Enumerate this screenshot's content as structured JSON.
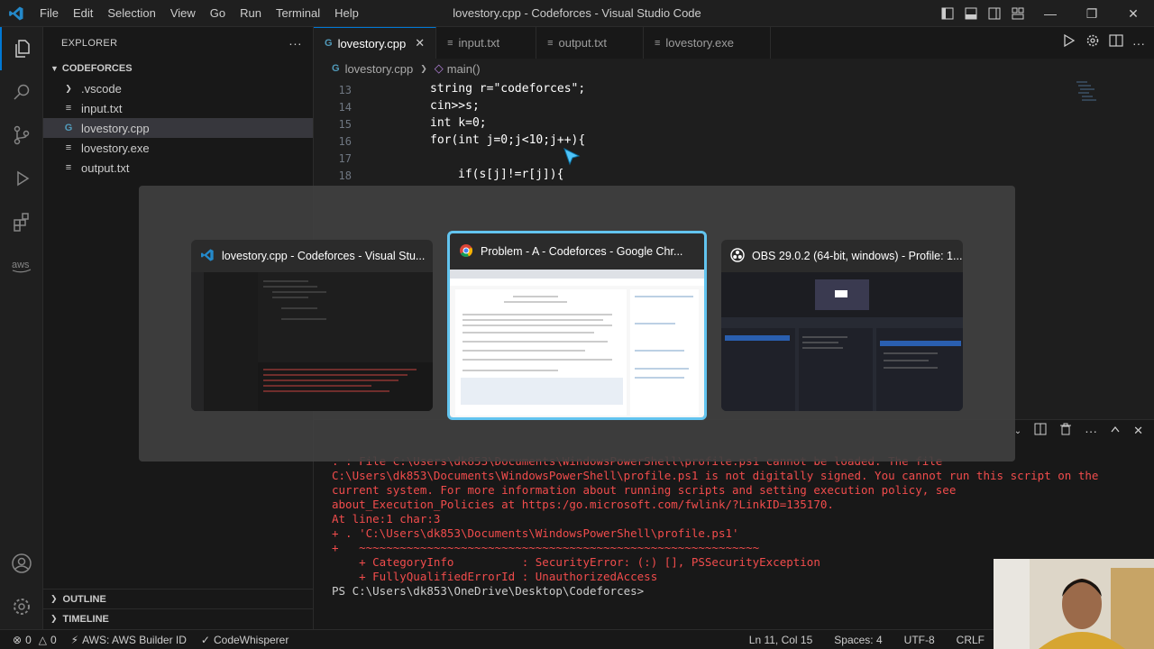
{
  "window": {
    "title": "lovestory.cpp - Codeforces - Visual Studio Code",
    "menu": [
      "File",
      "Edit",
      "Selection",
      "View",
      "Go",
      "Run",
      "Terminal",
      "Help"
    ]
  },
  "sidebar": {
    "header": "EXPLORER",
    "folder": "CODEFORCES",
    "items": [
      {
        "label": ".vscode",
        "icon": "chevron-right-icon"
      },
      {
        "label": "input.txt",
        "icon": "text-file-icon"
      },
      {
        "label": "lovestory.cpp",
        "icon": "cpp-file-icon"
      },
      {
        "label": "lovestory.exe",
        "icon": "text-file-icon"
      },
      {
        "label": "output.txt",
        "icon": "text-file-icon"
      }
    ],
    "outline": "OUTLINE",
    "timeline": "TIMELINE"
  },
  "tabs": [
    {
      "label": "lovestory.cpp",
      "active": true
    },
    {
      "label": "input.txt",
      "active": false
    },
    {
      "label": "output.txt",
      "active": false
    },
    {
      "label": "lovestory.exe",
      "active": false
    }
  ],
  "breadcrumb": {
    "file": "lovestory.cpp",
    "symbol": "main()"
  },
  "code": [
    {
      "num": "13",
      "text": "string r=\"codeforces\";"
    },
    {
      "num": "14",
      "text": "cin>>s;"
    },
    {
      "num": "15",
      "text": "int k=0;"
    },
    {
      "num": "16",
      "text": "for(int j=0;j<10;j++){"
    },
    {
      "num": "17",
      "text": ""
    },
    {
      "num": "18",
      "text": "if(s[j]!=r[j]){"
    }
  ],
  "terminal": {
    "lines": [
      ". : File C:\\Users\\dk853\\Documents\\WindowsPowerShell\\profile.ps1 cannot be loaded. The file",
      "C:\\Users\\dk853\\Documents\\WindowsPowerShell\\profile.ps1 is not digitally signed. You cannot run this script on the",
      "current system. For more information about running scripts and setting execution policy, see",
      "about_Execution_Policies at https:/go.microsoft.com/fwlink/?LinkID=135170.",
      "At line:1 char:3",
      "+ . 'C:\\Users\\dk853\\Documents\\WindowsPowerShell\\profile.ps1'",
      "+   ~~~~~~~~~~~~~~~~~~~~~~~~~~~~~~~~~~~~~~~~~~~~~~~~~~~~~~~~~~~",
      "    + CategoryInfo          : SecurityError: (:) [], PSSecurityException",
      "    + FullyQualifiedErrorId : UnauthorizedAccess"
    ],
    "prompt": "PS C:\\Users\\dk853\\OneDrive\\Desktop\\Codeforces>"
  },
  "switcher": {
    "windows": [
      {
        "title": "lovestory.cpp - Codeforces - Visual Stu...",
        "icon": "vscode-icon",
        "selected": false
      },
      {
        "title": "Problem - A - Codeforces - Google Chr...",
        "icon": "chrome-icon",
        "selected": true
      },
      {
        "title": "OBS 29.0.2 (64-bit, windows) - Profile: 1...",
        "icon": "obs-icon",
        "selected": false
      }
    ]
  },
  "status": {
    "errors": "0",
    "warnings": "0",
    "aws": "AWS: AWS Builder ID",
    "codewhisperer": "CodeWhisperer",
    "position": "Ln 11, Col 15",
    "spaces": "Spaces: 4",
    "encoding": "UTF-8",
    "eol": "CRLF"
  },
  "colors": {
    "accent": "#0078d4",
    "error": "#f14c4c",
    "selection": "#62c4ef"
  }
}
